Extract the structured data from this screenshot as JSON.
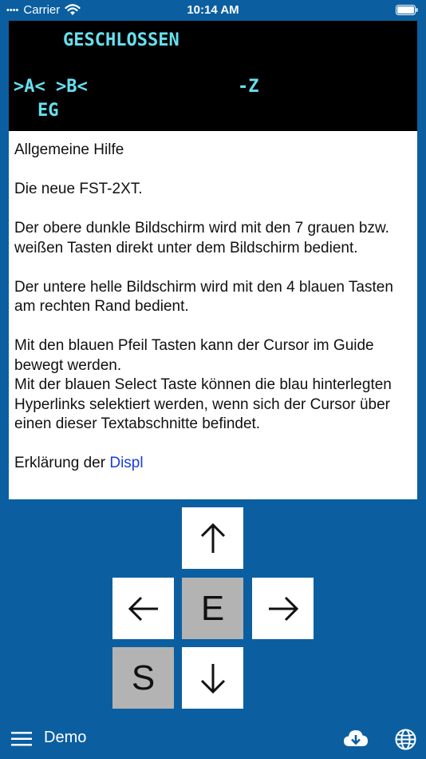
{
  "status_bar": {
    "carrier": "Carrier",
    "time": "10:14 AM",
    "signal": "••••"
  },
  "display": {
    "title": "GESCHLOSSEN",
    "keys_line": ">A< >B<",
    "z_label": "-Z",
    "eg_label": "EG"
  },
  "help": {
    "heading": "Allgemeine Hilfe",
    "intro": "Die neue FST-2XT.",
    "para_upper": "Der obere dunkle Bildschirm wird mit den 7 grauen bzw. weißen Tasten direkt unter dem Bildschirm bedient.",
    "para_lower": "Der untere helle Bildschirm wird mit den 4 blauen Tasten am rechten Rand bedient.",
    "para_arrows": "Mit den blauen Pfeil Tasten kann der Cursor im Guide bewegt werden.",
    "para_select": "Mit der blauen Select Taste können die blau hinterlegten Hyperlinks selektiert werden, wenn sich der Cursor über einen dieser Textabschnitte befindet.",
    "cut_text": "Erklärung der ",
    "cut_link": "Displ"
  },
  "keypad": {
    "e_label": "E",
    "s_label": "S",
    "up_icon": "arrow-up-icon",
    "down_icon": "arrow-down-icon",
    "left_icon": "arrow-left-icon",
    "right_icon": "arrow-right-icon"
  },
  "toolbar": {
    "title": "Demo",
    "menu_icon": "hamburger-menu-icon",
    "cloud_icon": "cloud-download-icon",
    "globe_icon": "globe-icon"
  },
  "colors": {
    "background": "#0b5fa0",
    "display_text": "#66e0f0",
    "link": "#1a3fd6",
    "key_gray": "#b3b3b3"
  }
}
